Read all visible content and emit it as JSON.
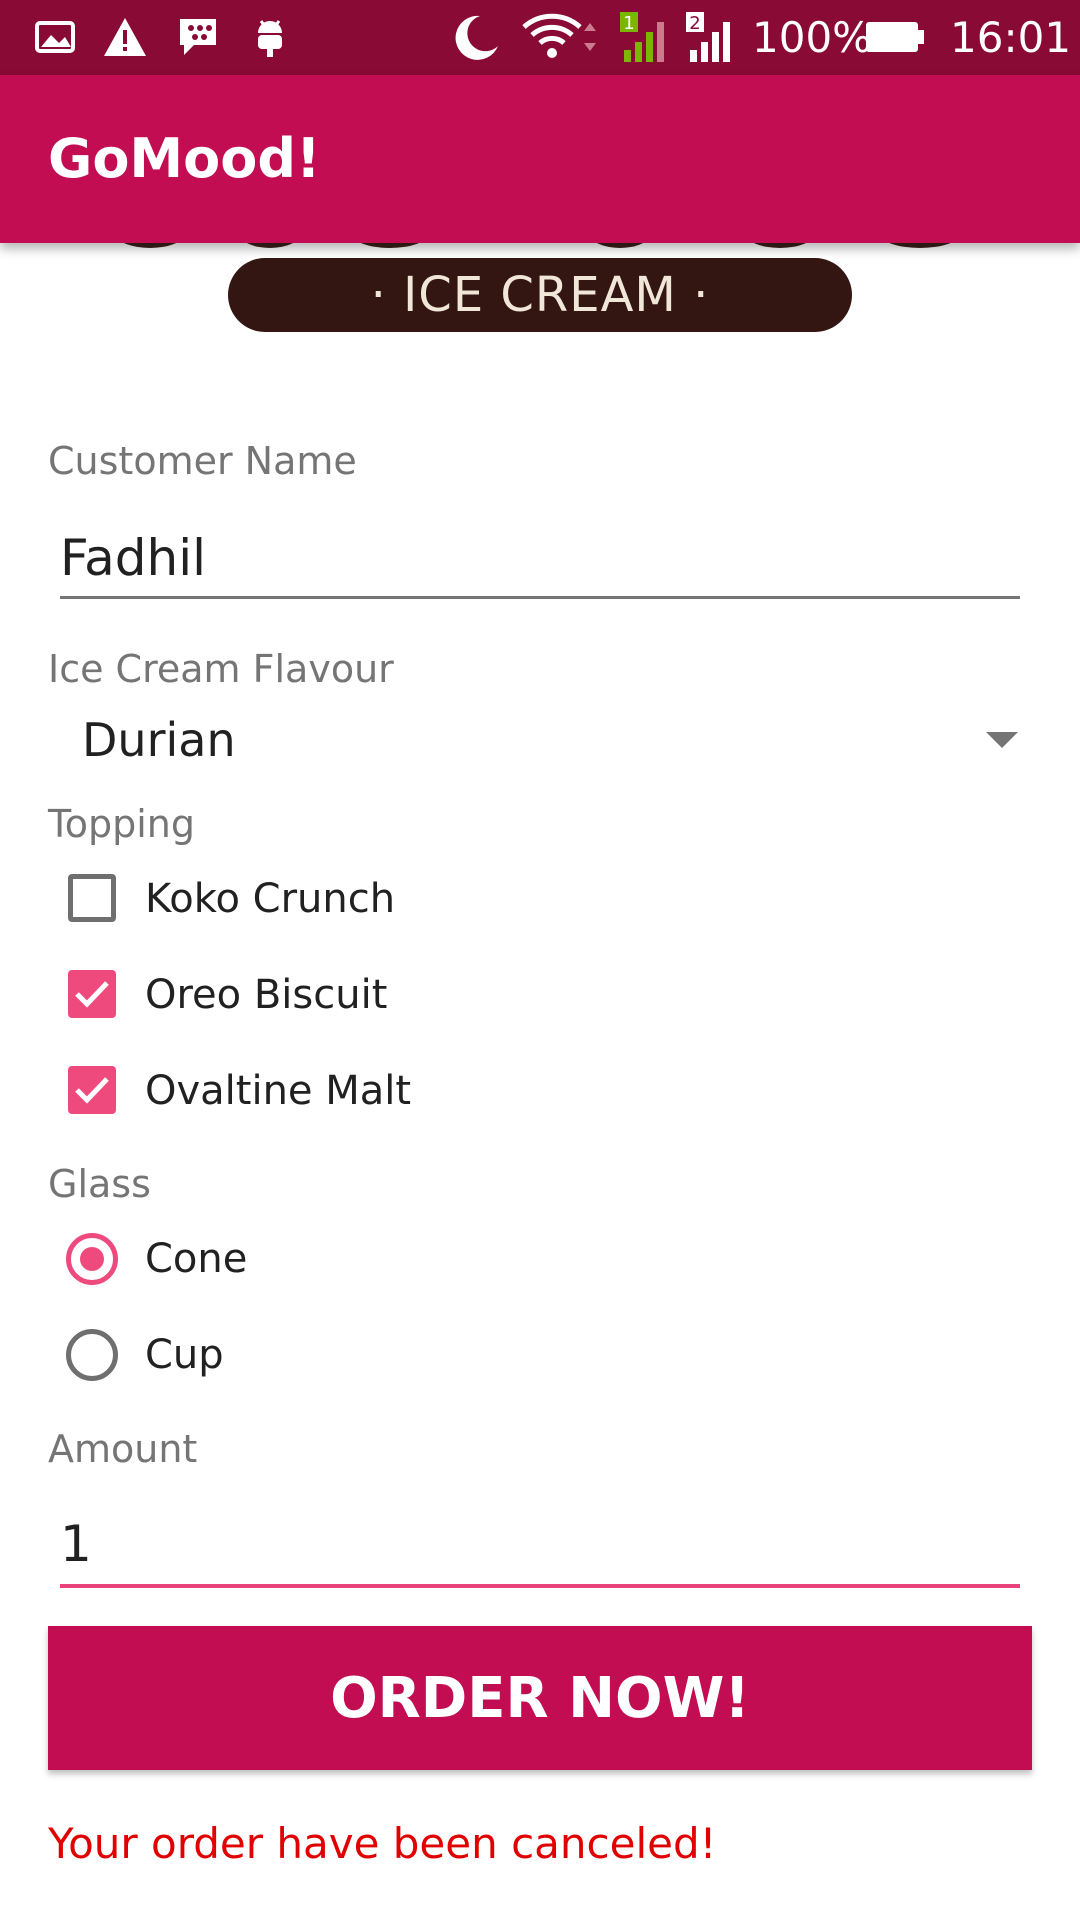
{
  "status_bar": {
    "battery": "100%",
    "time": "16:01",
    "sim1": "1",
    "sim2": "2",
    "icons": [
      "gallery-icon",
      "warning-icon",
      "bbm-icon",
      "android-icon",
      "moon-icon",
      "wifi-icon",
      "signal-sim1-icon",
      "signal-sim2-icon",
      "battery-icon"
    ]
  },
  "app_bar": {
    "title": "GoMood!"
  },
  "banner": {
    "text": "· ICE CREAM ·"
  },
  "form": {
    "customer_name": {
      "label": "Customer Name",
      "value": "Fadhil"
    },
    "flavour": {
      "label": "Ice Cream Flavour",
      "value": "Durian"
    },
    "topping": {
      "label": "Topping",
      "options": [
        {
          "label": "Koko Crunch",
          "checked": false
        },
        {
          "label": "Oreo Biscuit",
          "checked": true
        },
        {
          "label": "Ovaltine Malt",
          "checked": true
        }
      ]
    },
    "glass": {
      "label": "Glass",
      "options": [
        {
          "label": "Cone",
          "selected": true
        },
        {
          "label": "Cup",
          "selected": false
        }
      ]
    },
    "amount": {
      "label": "Amount",
      "value": "1"
    }
  },
  "order_button": {
    "label": "ORDER NOW!"
  },
  "status_message": "Your order have been canceled!",
  "colors": {
    "status_bar": "#880a35",
    "app_bar": "#c20d52",
    "accent": "#ef4a7e",
    "error_text": "#e00000"
  }
}
